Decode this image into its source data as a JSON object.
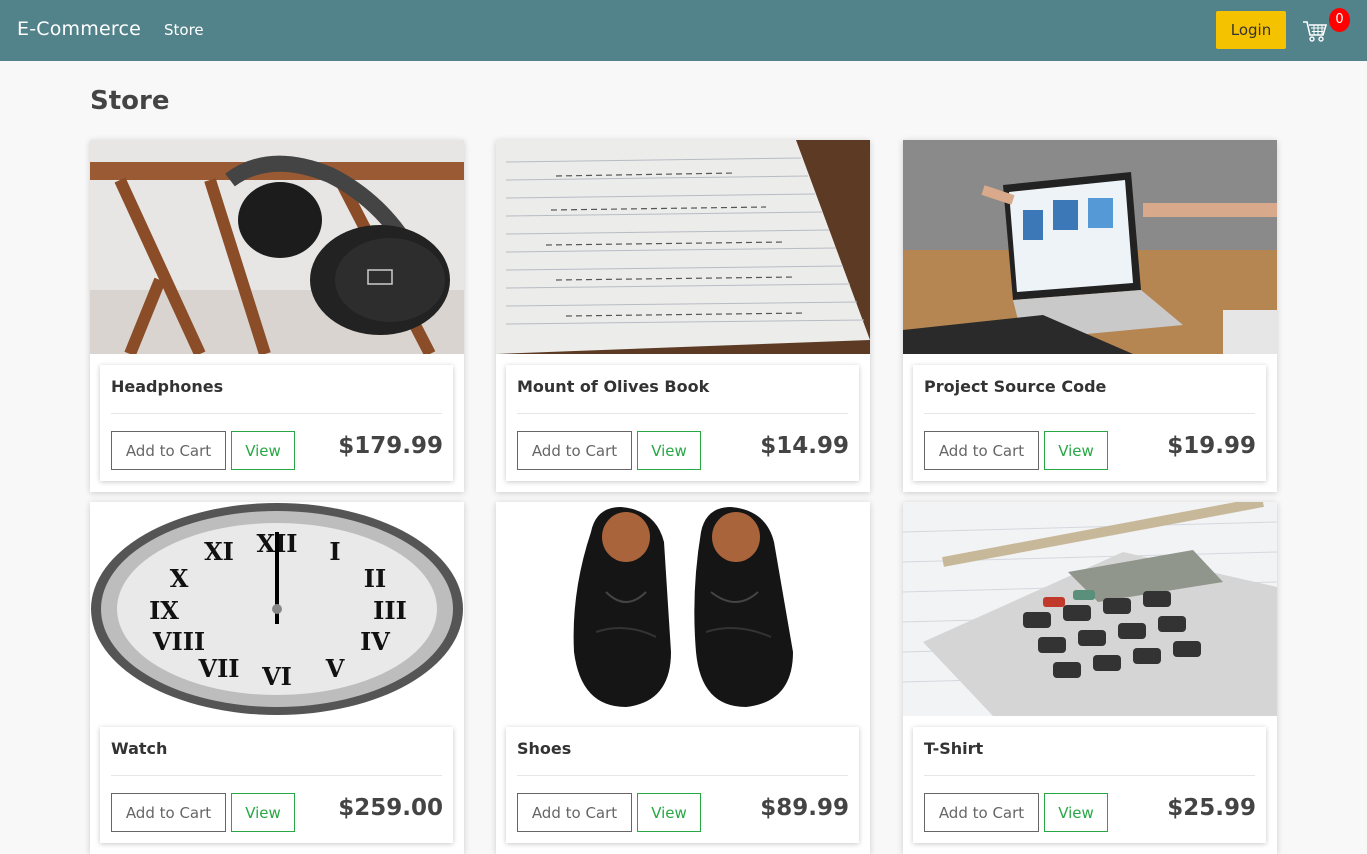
{
  "navbar": {
    "brand": "E-Commerce",
    "store_link": "Store",
    "login_label": "Login",
    "cart_count": "0",
    "colors": {
      "navbar": "#52838a",
      "login": "#f5c200",
      "badge": "#ff0000"
    }
  },
  "page": {
    "title": "Store"
  },
  "products": [
    {
      "name": "Headphones",
      "price": "$179.99",
      "add_label": "Add to Cart",
      "view_label": "View",
      "image": "headphones-photo"
    },
    {
      "name": "Mount of Olives Book",
      "price": "$14.99",
      "add_label": "Add to Cart",
      "view_label": "View",
      "image": "notebook-photo"
    },
    {
      "name": "Project Source Code",
      "price": "$19.99",
      "add_label": "Add to Cart",
      "view_label": "View",
      "image": "laptop-photo"
    },
    {
      "name": "Watch",
      "price": "$259.00",
      "add_label": "Add to Cart",
      "view_label": "View",
      "image": "clock-photo"
    },
    {
      "name": "Shoes",
      "price": "$89.99",
      "add_label": "Add to Cart",
      "view_label": "View",
      "image": "shoes-photo"
    },
    {
      "name": "T-Shirt",
      "price": "$25.99",
      "add_label": "Add to Cart",
      "view_label": "View",
      "image": "calculator-photo"
    }
  ]
}
